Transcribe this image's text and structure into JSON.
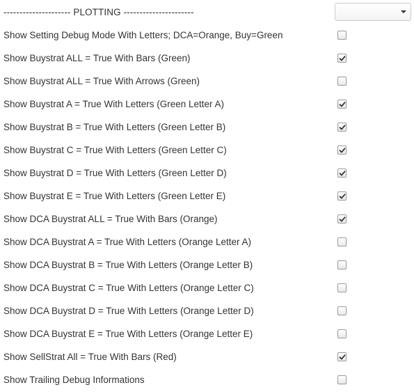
{
  "plotting_header": {
    "label": "--------------------- PLOTTING ----------------------",
    "select_value": ""
  },
  "settings": [
    {
      "label": "Show Setting Debug Mode With Letters; DCA=Orange, Buy=Green",
      "checked": false
    },
    {
      "label": "Show Buystrat ALL = True With Bars (Green)",
      "checked": true
    },
    {
      "label": "Show Buystrat ALL = True With Arrows (Green)",
      "checked": false
    },
    {
      "label": "Show Buystrat A = True With Letters (Green Letter A)",
      "checked": true
    },
    {
      "label": "Show Buystrat B = True With Letters (Green Letter B)",
      "checked": true
    },
    {
      "label": "Show Buystrat C = True With Letters (Green Letter C)",
      "checked": true
    },
    {
      "label": "Show Buystrat D = True With Letters (Green Letter D)",
      "checked": true
    },
    {
      "label": "Show Buystrat E = True With Letters (Green Letter E)",
      "checked": true
    },
    {
      "label": "Show DCA Buystrat ALL = True With Bars (Orange)",
      "checked": true
    },
    {
      "label": "Show DCA Buystrat A = True With Letters (Orange Letter A)",
      "checked": false
    },
    {
      "label": "Show DCA Buystrat B = True With Letters (Orange Letter B)",
      "checked": false
    },
    {
      "label": "Show DCA Buystrat C = True With Letters (Orange Letter C)",
      "checked": false
    },
    {
      "label": "Show DCA Buystrat D = True With Letters (Orange Letter D)",
      "checked": false
    },
    {
      "label": "Show DCA Buystrat E = True With Letters (Orange Letter E)",
      "checked": false
    },
    {
      "label": "Show SellStrat All = True With Bars (Red)",
      "checked": true
    },
    {
      "label": "Show Trailing Debug Informations",
      "checked": false
    }
  ],
  "colors": {
    "text": "#333333",
    "checkbox_border": "#9a9a9a",
    "checkmark": "#333333"
  }
}
